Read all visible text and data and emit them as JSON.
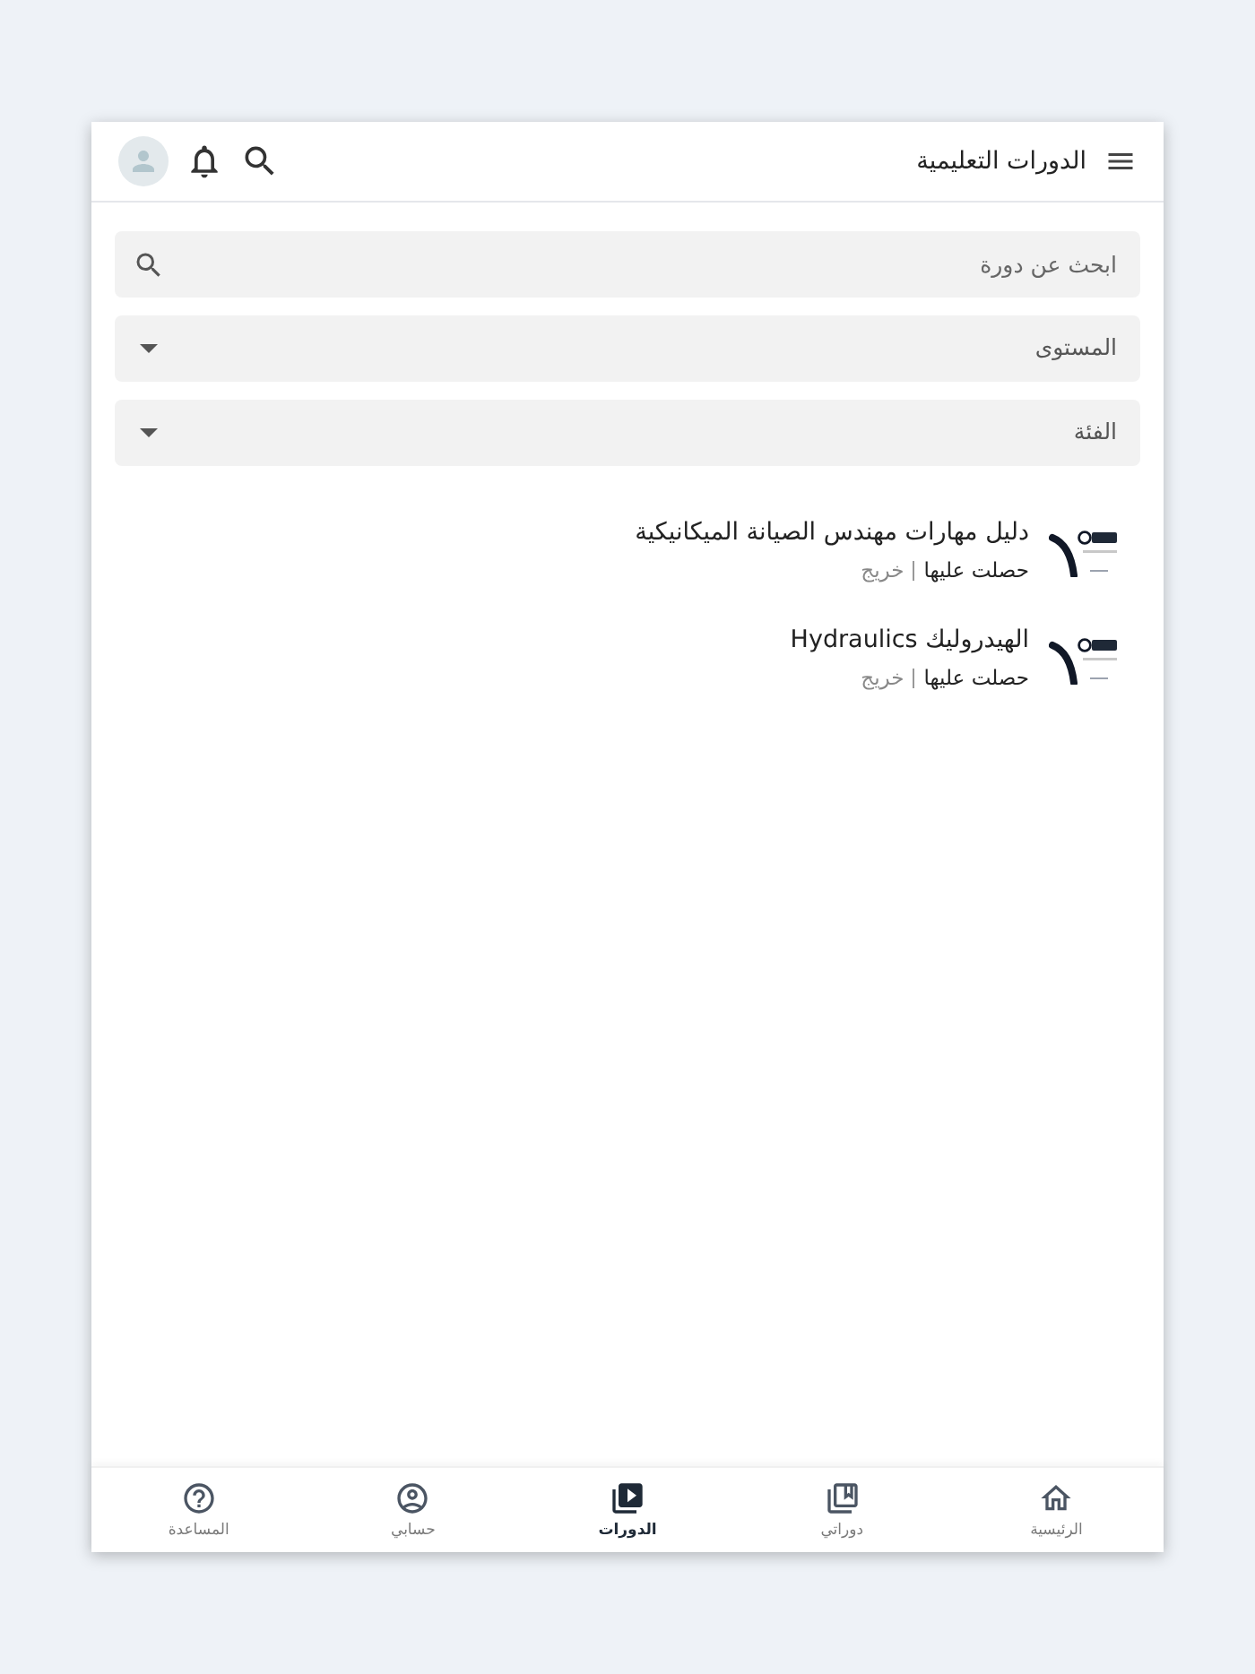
{
  "app_bar": {
    "title": "الدورات التعليمية"
  },
  "search": {
    "placeholder": "ابحث عن دورة"
  },
  "filters": [
    {
      "label": "المستوى"
    },
    {
      "label": "الفئة"
    }
  ],
  "courses": [
    {
      "title": "دليل مهارات مهندس الصيانة الميكانيكية",
      "status": "حصلت عليها",
      "rank": "خريج"
    },
    {
      "title": "الهيدروليك Hydraulics",
      "status": "حصلت عليها",
      "rank": "خريج"
    }
  ],
  "nav_items": [
    {
      "label": "الرئيسية",
      "kind": "home",
      "selected": false
    },
    {
      "label": "دوراتي",
      "kind": "my_courses",
      "selected": false
    },
    {
      "label": "الدورات",
      "kind": "courses",
      "selected": true
    },
    {
      "label": "حسابي",
      "kind": "account",
      "selected": false
    },
    {
      "label": "المساعدة",
      "kind": "help",
      "selected": false
    }
  ]
}
